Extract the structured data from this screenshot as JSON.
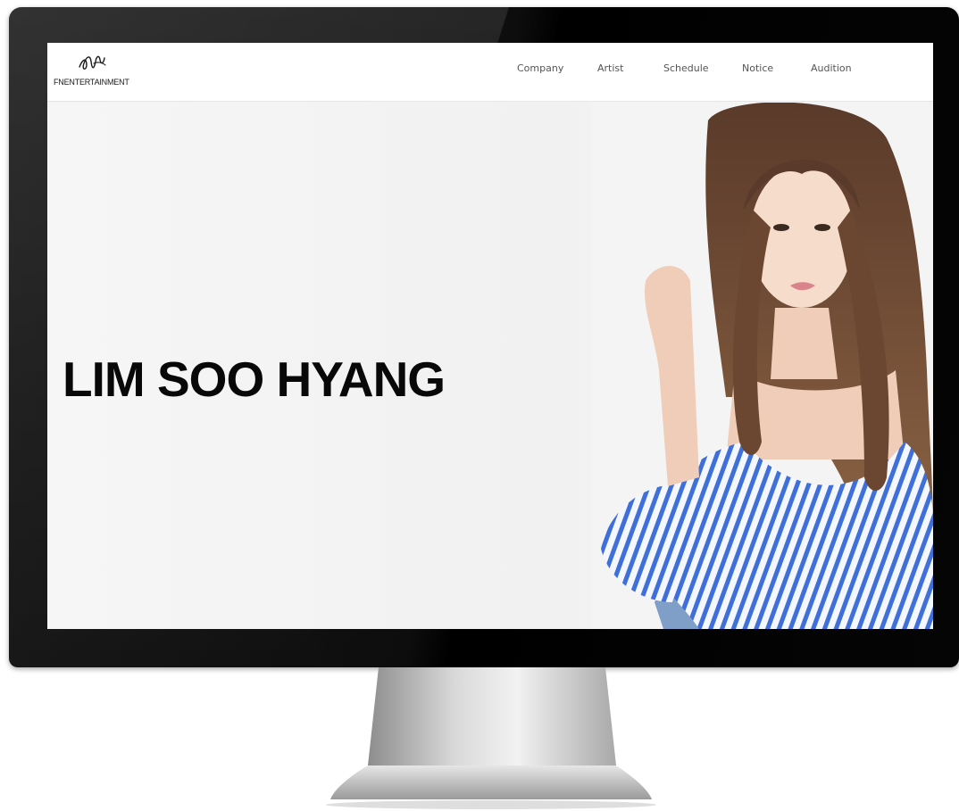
{
  "brand": {
    "logo_text": "FNENTERTAINMENT",
    "accent": "#080808"
  },
  "nav": {
    "items": [
      {
        "label": "Company"
      },
      {
        "label": "Artist"
      },
      {
        "label": "Schedule"
      },
      {
        "label": "Notice"
      },
      {
        "label": "Audition"
      }
    ]
  },
  "hero": {
    "title": "LIM SOO HYANG",
    "photo_icon": "artist-portrait-photo"
  },
  "colors": {
    "bezel": "#0d0d0d",
    "screen_bg": "#f3f3f3",
    "nav_text": "#555555",
    "shirt_stripe": "#3f6fd8"
  }
}
